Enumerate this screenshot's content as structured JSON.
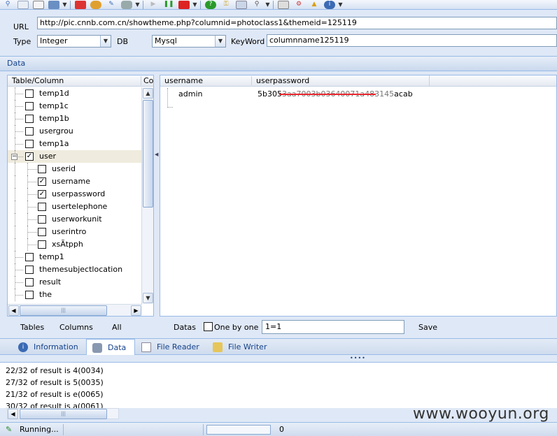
{
  "toolbar": {
    "buttons": [
      "search-icon",
      "document-icon",
      "page-icon",
      "3d-box-icon",
      "chart-icon",
      "palette-icon",
      "tool-icon",
      "cylinder-icon",
      "play-icon",
      "pause-icon",
      "stop-icon",
      "help-icon",
      "key-icon",
      "image-icon",
      "magnifier-icon",
      "home-icon",
      "gear-icon",
      "upload-icon",
      "info-icon"
    ]
  },
  "params": {
    "url_label": "URL",
    "url_value": "http://pic.cnnb.com.cn/showtheme.php?columnid=photoclass1&themeid=125119",
    "type_label": "Type",
    "type_value": "Integer",
    "db_label": "DB",
    "db_value": "Mysql",
    "keyword_label": "KeyWord",
    "keyword_value": "columnname125119"
  },
  "data_panel": {
    "title": "Data",
    "left_headers": [
      "Table/Column",
      "Cou"
    ],
    "tree": [
      {
        "label": "temp1d",
        "checked": false,
        "level": 0
      },
      {
        "label": "temp1c",
        "checked": false,
        "level": 0
      },
      {
        "label": "temp1b",
        "checked": false,
        "level": 0
      },
      {
        "label": "usergrou",
        "checked": false,
        "level": 0
      },
      {
        "label": "temp1a",
        "checked": false,
        "level": 0
      },
      {
        "label": "user",
        "checked": true,
        "level": 0,
        "expanded": true,
        "selected": true
      },
      {
        "label": "userid",
        "checked": false,
        "level": 1
      },
      {
        "label": "username",
        "checked": true,
        "level": 1
      },
      {
        "label": "userpassword",
        "checked": true,
        "level": 1
      },
      {
        "label": "usertelephone",
        "checked": false,
        "level": 1
      },
      {
        "label": "userworkunit",
        "checked": false,
        "level": 1
      },
      {
        "label": "userintro",
        "checked": false,
        "level": 1
      },
      {
        "label": "xsÃtpph",
        "checked": false,
        "level": 1
      },
      {
        "label": "temp1",
        "checked": false,
        "level": 0
      },
      {
        "label": "themesubjectlocation",
        "checked": false,
        "level": 0
      },
      {
        "label": "result",
        "checked": false,
        "level": 0
      },
      {
        "label": "the",
        "checked": false,
        "level": 0
      }
    ],
    "right_headers": [
      "username",
      "userpassword"
    ],
    "rows": [
      {
        "username": "admin",
        "userpassword_prefix": "5b305",
        "userpassword_redacted": "3aa7003b03640071a483145",
        "userpassword_suffix": "acab"
      }
    ]
  },
  "bottom_left": {
    "tables_label": "Tables",
    "columns_label": "Columns",
    "all_label": "All"
  },
  "bottom_right": {
    "datas_label": "Datas",
    "one_by_one_label": "One by one",
    "input_value": "1=1",
    "save_label": "Save"
  },
  "tabs": [
    {
      "label": "Information",
      "icon": "info-icon"
    },
    {
      "label": "Data",
      "icon": "database-icon",
      "active": true
    },
    {
      "label": "File Reader",
      "icon": "file-icon"
    },
    {
      "label": "File Writer",
      "icon": "pencil-icon"
    }
  ],
  "log": [
    "22/32 of result is 4(0034)",
    "27/32 of result is 5(0035)",
    "21/32 of result is e(0065)",
    "30/32 of result is a(0061)"
  ],
  "status": {
    "running_text": "Running...",
    "progress": 0,
    "count": "0"
  },
  "watermark": "www.wooyun.org"
}
